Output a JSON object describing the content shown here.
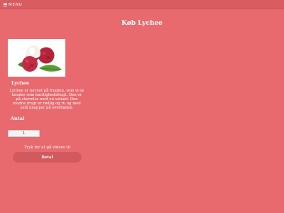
{
  "nav": {
    "menu_label": "MENU",
    "menu_icon": "hamburger-icon"
  },
  "page": {
    "title": "Køb Lychee"
  },
  "product": {
    "name": "Lychee",
    "description": "Lychee er navnet på frugten, som vi os kender som kærlighedsfrugt. Den er på størrelse med en valnød. Den modne frugt er rødlig og ru og med små knopper på overfladen.",
    "image_alt": "Lychee"
  },
  "quantity": {
    "label": "Antal",
    "value": "1"
  },
  "checkout": {
    "hint": "Tryk for at gå videre til",
    "pay_label": "Betal"
  },
  "colors": {
    "background": "#e86a6e",
    "topbar": "#d95c60",
    "button": "#d25a5e"
  }
}
